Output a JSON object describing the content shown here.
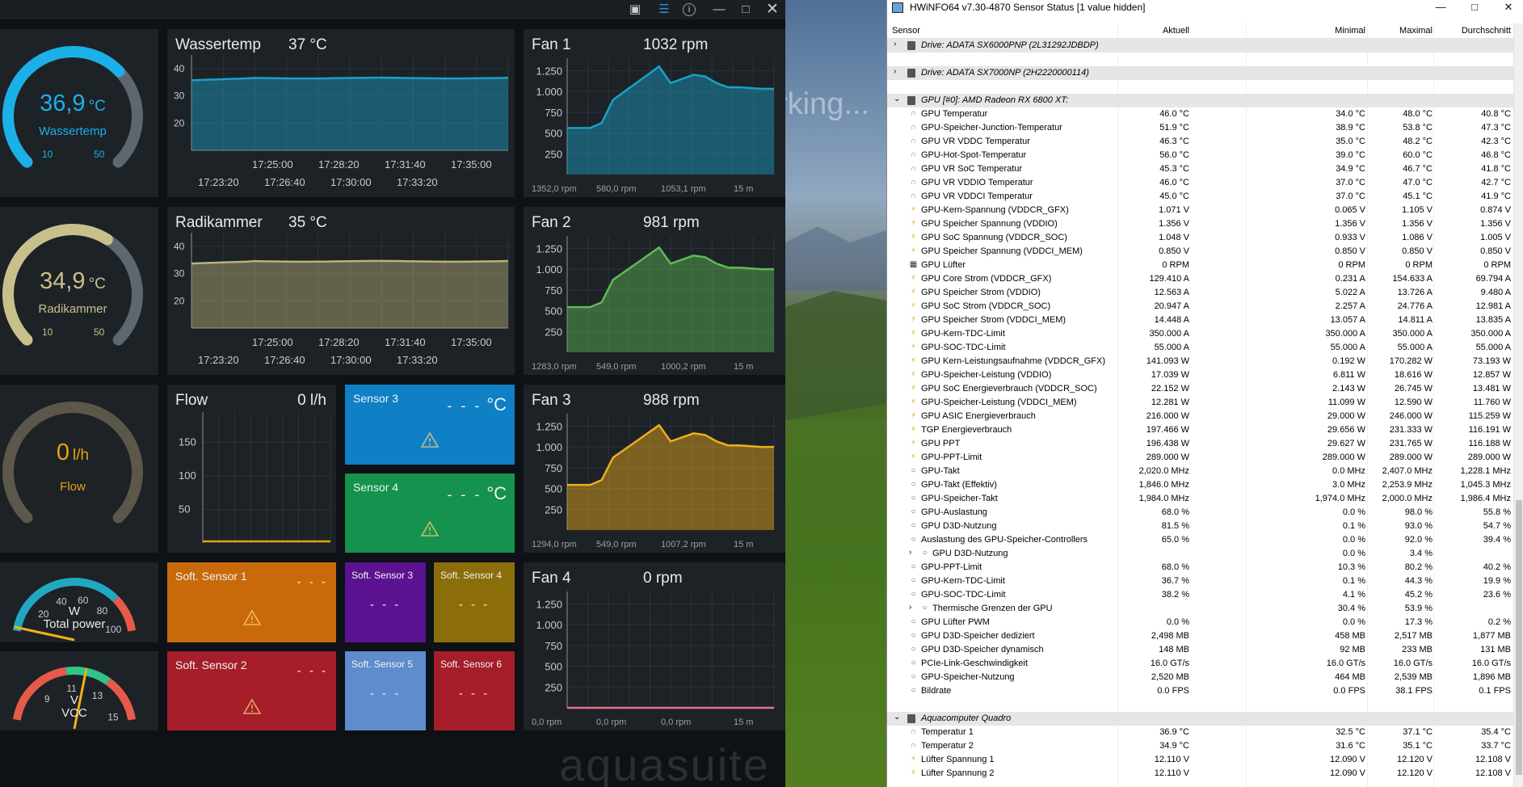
{
  "aquasuite": {
    "watermark": "aquasuite",
    "gauges": [
      {
        "value": "36,9",
        "unit": "°C",
        "label": "Wassertemp",
        "min": "10",
        "max": "50",
        "color": "#1ab0e8",
        "fraction": 0.67
      },
      {
        "value": "34,9",
        "unit": "°C",
        "label": "Radikammer",
        "min": "10",
        "max": "50",
        "color": "#c8c08a",
        "fraction": 0.62
      },
      {
        "value": "0",
        "unit": "l/h",
        "label": "Flow",
        "color": "#e8a20e",
        "fraction": 0.0
      }
    ],
    "temp_charts": [
      {
        "title": "Wassertemp",
        "value": "37 °C",
        "color": "#1aa0c8",
        "yticks": [
          "40",
          "30",
          "20"
        ],
        "xticks_top": [
          "17:25:00",
          "17:28:20",
          "17:31:40",
          "17:35:00"
        ],
        "xticks_bottom": [
          "17:23:20",
          "17:26:40",
          "17:30:00",
          "17:33:20"
        ]
      },
      {
        "title": "Radikammer",
        "value": "35 °C",
        "color": "#b9b27a",
        "yticks": [
          "40",
          "30",
          "20"
        ],
        "xticks_top": [
          "17:25:00",
          "17:28:20",
          "17:31:40",
          "17:35:00"
        ],
        "xticks_bottom": [
          "17:23:20",
          "17:26:40",
          "17:30:00",
          "17:33:20"
        ]
      }
    ],
    "flow_chart": {
      "title": "Flow",
      "value": "0 l/h",
      "yticks": [
        "150",
        "100",
        "50"
      ]
    },
    "fans": [
      {
        "title": "Fan 1",
        "value": "1032 rpm",
        "color": "#1aa0c8",
        "footer": [
          "1352,0 rpm",
          "580,0 rpm",
          "1053,1 rpm",
          "15 m"
        ]
      },
      {
        "title": "Fan 2",
        "value": "981 rpm",
        "color": "#5fbb57",
        "footer": [
          "1283,0 rpm",
          "549,0 rpm",
          "1000,2 rpm",
          "15 m"
        ]
      },
      {
        "title": "Fan 3",
        "value": "988 rpm",
        "color": "#efae1a",
        "footer": [
          "1294,0 rpm",
          "549,0 rpm",
          "1007,2 rpm",
          "15 m"
        ]
      },
      {
        "title": "Fan 4",
        "value": "0 rpm",
        "color": "#e8708a",
        "footer": [
          "0,0 rpm",
          "0,0 rpm",
          "0,0 rpm",
          "15 m"
        ]
      }
    ],
    "fan_yticks": [
      "1.250",
      "1.000",
      "750",
      "500",
      "250"
    ],
    "sensors": [
      {
        "title": "Sensor 3",
        "value": "- - -",
        "unit": "°C",
        "color": "#0f80c5"
      },
      {
        "title": "Sensor 4",
        "value": "- - -",
        "unit": "°C",
        "color": "#15924d"
      }
    ],
    "soft_sensors": [
      {
        "title": "Soft. Sensor 1",
        "value": "- - -",
        "color": "#c96a0a"
      },
      {
        "title": "Soft. Sensor 2",
        "value": "- - -",
        "color": "#a51e2a"
      },
      {
        "title": "Soft. Sensor 3",
        "value": "- - -",
        "color": "#5c1391"
      },
      {
        "title": "Soft. Sensor 4",
        "value": "- - -",
        "color": "#8b6e09"
      },
      {
        "title": "Soft. Sensor 5",
        "value": "- - -",
        "color": "#5f8ccd"
      },
      {
        "title": "Soft. Sensor 6",
        "value": "- - -",
        "color": "#a51e2a"
      }
    ],
    "power_gauge": {
      "unit": "W",
      "label": "Total power",
      "ticks": [
        "20",
        "40",
        "60",
        "80",
        "100"
      ],
      "fraction": 0.02
    },
    "vcc_gauge": {
      "unit": "V",
      "label": "VCC",
      "ticks": [
        "9",
        "11",
        "13",
        "15"
      ],
      "fraction": 0.57
    }
  },
  "scene": {
    "text": "rking..."
  },
  "hwinfo": {
    "title": "HWiNFO64 v7.30-4870 Sensor Status [1 value hidden]",
    "columns": [
      "Sensor",
      "Aktuell",
      "Minimal",
      "Maximal",
      "Durchschnitt"
    ],
    "groups": [
      {
        "name": "Drive: ADATA SX6000PNP (2L31292JDBDP)",
        "rows": []
      },
      {
        "name": "Drive: ADATA SX7000NP (2H2220000114)",
        "rows": []
      },
      {
        "name": "GPU [#0]: AMD Radeon RX 6800 XT:",
        "rows": [
          {
            "icon": "thermometer",
            "name": "GPU Temperatur",
            "v": [
              "46.0 °C",
              "34.0 °C",
              "48.0 °C",
              "40.8 °C"
            ]
          },
          {
            "icon": "thermometer",
            "name": "GPU-Speicher-Junction-Temperatur",
            "v": [
              "51.9 °C",
              "38.9 °C",
              "53.8 °C",
              "47.3 °C"
            ]
          },
          {
            "icon": "thermometer",
            "name": "GPU VR VDDC Temperatur",
            "v": [
              "46.3 °C",
              "35.0 °C",
              "48.2 °C",
              "42.3 °C"
            ]
          },
          {
            "icon": "thermometer",
            "name": "GPU-Hot-Spot-Temperatur",
            "v": [
              "56.0 °C",
              "39.0 °C",
              "60.0 °C",
              "46.8 °C"
            ]
          },
          {
            "icon": "thermometer",
            "name": "GPU VR SoC Temperatur",
            "v": [
              "45.3 °C",
              "34.9 °C",
              "46.7 °C",
              "41.8 °C"
            ]
          },
          {
            "icon": "thermometer",
            "name": "GPU VR VDDIO Temperatur",
            "v": [
              "46.0 °C",
              "37.0 °C",
              "47.0 °C",
              "42.7 °C"
            ]
          },
          {
            "icon": "thermometer",
            "name": "GPU VR VDDCI Temperatur",
            "v": [
              "45.0 °C",
              "37.0 °C",
              "45.1 °C",
              "41.9 °C"
            ]
          },
          {
            "icon": "bolt",
            "name": "GPU-Kern-Spannung (VDDCR_GFX)",
            "v": [
              "1.071 V",
              "0.065 V",
              "1.105 V",
              "0.874 V"
            ]
          },
          {
            "icon": "bolt",
            "name": "GPU Speicher Spannung (VDDIO)",
            "v": [
              "1.356 V",
              "1.356 V",
              "1.356 V",
              "1.356 V"
            ]
          },
          {
            "icon": "bolt",
            "name": "GPU SoC Spannung (VDDCR_SOC)",
            "v": [
              "1.048 V",
              "0.933 V",
              "1.086 V",
              "1.005 V"
            ]
          },
          {
            "icon": "bolt",
            "name": "GPU Speicher Spannung (VDDCI_MEM)",
            "v": [
              "0.850 V",
              "0.850 V",
              "0.850 V",
              "0.850 V"
            ]
          },
          {
            "icon": "fan",
            "name": "GPU Lüfter",
            "v": [
              "0 RPM",
              "0 RPM",
              "0 RPM",
              "0 RPM"
            ]
          },
          {
            "icon": "bolt",
            "name": "GPU Core Strom (VDDCR_GFX)",
            "v": [
              "129.410 A",
              "0.231 A",
              "154.633 A",
              "69.794 A"
            ]
          },
          {
            "icon": "bolt",
            "name": "GPU Speicher Strom (VDDIO)",
            "v": [
              "12.563 A",
              "5.022 A",
              "13.726 A",
              "9.480 A"
            ]
          },
          {
            "icon": "bolt",
            "name": "GPU SoC Strom (VDDCR_SOC)",
            "v": [
              "20.947 A",
              "2.257 A",
              "24.776 A",
              "12.981 A"
            ]
          },
          {
            "icon": "bolt",
            "name": "GPU Speicher Strom (VDDCI_MEM)",
            "v": [
              "14.448 A",
              "13.057 A",
              "14.811 A",
              "13.835 A"
            ]
          },
          {
            "icon": "bolt",
            "name": "GPU-Kern-TDC-Limit",
            "v": [
              "350.000 A",
              "350.000 A",
              "350.000 A",
              "350.000 A"
            ]
          },
          {
            "icon": "bolt",
            "name": "GPU-SOC-TDC-Limit",
            "v": [
              "55.000 A",
              "55.000 A",
              "55.000 A",
              "55.000 A"
            ]
          },
          {
            "icon": "bolt",
            "name": "GPU Kern-Leistungsaufnahme (VDDCR_GFX)",
            "v": [
              "141.093 W",
              "0.192 W",
              "170.282 W",
              "73.193 W"
            ]
          },
          {
            "icon": "bolt",
            "name": "GPU-Speicher-Leistung (VDDIO)",
            "v": [
              "17.039 W",
              "6.811 W",
              "18.616 W",
              "12.857 W"
            ]
          },
          {
            "icon": "bolt",
            "name": "GPU SoC Energieverbrauch (VDDCR_SOC)",
            "v": [
              "22.152 W",
              "2.143 W",
              "26.745 W",
              "13.481 W"
            ]
          },
          {
            "icon": "bolt",
            "name": "GPU-Speicher-Leistung (VDDCI_MEM)",
            "v": [
              "12.281 W",
              "11.099 W",
              "12.590 W",
              "11.760 W"
            ]
          },
          {
            "icon": "bolt",
            "name": "GPU ASIC Energieverbrauch",
            "v": [
              "216.000 W",
              "29.000 W",
              "246.000 W",
              "115.259 W"
            ]
          },
          {
            "icon": "bolt",
            "name": "TGP Energieverbrauch",
            "v": [
              "197.466 W",
              "29.656 W",
              "231.333 W",
              "116.191 W"
            ]
          },
          {
            "icon": "bolt",
            "name": "GPU PPT",
            "v": [
              "196.438 W",
              "29.627 W",
              "231.765 W",
              "116.188 W"
            ]
          },
          {
            "icon": "bolt",
            "name": "GPU-PPT-Limit",
            "v": [
              "289.000 W",
              "289.000 W",
              "289.000 W",
              "289.000 W"
            ]
          },
          {
            "icon": "clock",
            "name": "GPU-Takt",
            "v": [
              "2,020.0 MHz",
              "0.0 MHz",
              "2,407.0 MHz",
              "1,228.1 MHz"
            ]
          },
          {
            "icon": "clock",
            "name": "GPU-Takt (Effektiv)",
            "v": [
              "1,846.0 MHz",
              "3.0 MHz",
              "2,253.9 MHz",
              "1,045.3 MHz"
            ]
          },
          {
            "icon": "clock",
            "name": "GPU-Speicher-Takt",
            "v": [
              "1,984.0 MHz",
              "1,974.0 MHz",
              "2,000.0 MHz",
              "1,986.4 MHz"
            ]
          },
          {
            "icon": "clock",
            "name": "GPU-Auslastung",
            "v": [
              "68.0 %",
              "0.0 %",
              "98.0 %",
              "55.8 %"
            ]
          },
          {
            "icon": "clock",
            "name": "GPU D3D-Nutzung",
            "v": [
              "81.5 %",
              "0.1 %",
              "93.0 %",
              "54.7 %"
            ]
          },
          {
            "icon": "clock",
            "name": "Auslastung des GPU-Speicher-Controllers",
            "v": [
              "65.0 %",
              "0.0 %",
              "92.0 %",
              "39.4 %"
            ]
          },
          {
            "icon": "clock",
            "sub": true,
            "name": "GPU D3D-Nutzung",
            "v": [
              "",
              "0.0 %",
              "3.4 %",
              ""
            ]
          },
          {
            "icon": "clock",
            "name": "GPU-PPT-Limit",
            "v": [
              "68.0 %",
              "10.3 %",
              "80.2 %",
              "40.2 %"
            ]
          },
          {
            "icon": "clock",
            "name": "GPU-Kern-TDC-Limit",
            "v": [
              "36.7 %",
              "0.1 %",
              "44.3 %",
              "19.9 %"
            ]
          },
          {
            "icon": "clock",
            "name": "GPU-SOC-TDC-Limit",
            "v": [
              "38.2 %",
              "4.1 %",
              "45.2 %",
              "23.6 %"
            ]
          },
          {
            "icon": "clock",
            "sub": true,
            "name": "Thermische Grenzen der GPU",
            "v": [
              "",
              "30.4 %",
              "53.9 %",
              ""
            ]
          },
          {
            "icon": "clock",
            "name": "GPU Lüfter PWM",
            "v": [
              "0.0 %",
              "0.0 %",
              "17.3 %",
              "0.2 %"
            ]
          },
          {
            "icon": "clock",
            "name": "GPU D3D-Speicher dediziert",
            "v": [
              "2,498 MB",
              "458 MB",
              "2,517 MB",
              "1,877 MB"
            ]
          },
          {
            "icon": "clock",
            "name": "GPU D3D-Speicher dynamisch",
            "v": [
              "148 MB",
              "92 MB",
              "233 MB",
              "131 MB"
            ]
          },
          {
            "icon": "clock",
            "name": "PCIe-Link-Geschwindigkeit",
            "v": [
              "16.0 GT/s",
              "16.0 GT/s",
              "16.0 GT/s",
              "16.0 GT/s"
            ]
          },
          {
            "icon": "clock",
            "name": "GPU-Speicher-Nutzung",
            "v": [
              "2,520 MB",
              "464 MB",
              "2,539 MB",
              "1,896 MB"
            ]
          },
          {
            "icon": "clock",
            "name": "Bildrate",
            "v": [
              "0.0 FPS",
              "0.0 FPS",
              "38.1 FPS",
              "0.1 FPS"
            ]
          }
        ]
      },
      {
        "name": "Aquacomputer Quadro",
        "rows": [
          {
            "icon": "thermometer",
            "name": "Temperatur 1",
            "v": [
              "36.9 °C",
              "32.5 °C",
              "37.1 °C",
              "35.4 °C"
            ]
          },
          {
            "icon": "thermometer",
            "name": "Temperatur 2",
            "v": [
              "34.9 °C",
              "31.6 °C",
              "35.1 °C",
              "33.7 °C"
            ]
          },
          {
            "icon": "bolt",
            "name": "Lüfter Spannung 1",
            "v": [
              "12.110 V",
              "12.090 V",
              "12.120 V",
              "12.108 V"
            ]
          },
          {
            "icon": "bolt",
            "name": "Lüfter Spannung 2",
            "v": [
              "12.110 V",
              "12.090 V",
              "12.120 V",
              "12.108 V"
            ]
          }
        ]
      }
    ]
  }
}
